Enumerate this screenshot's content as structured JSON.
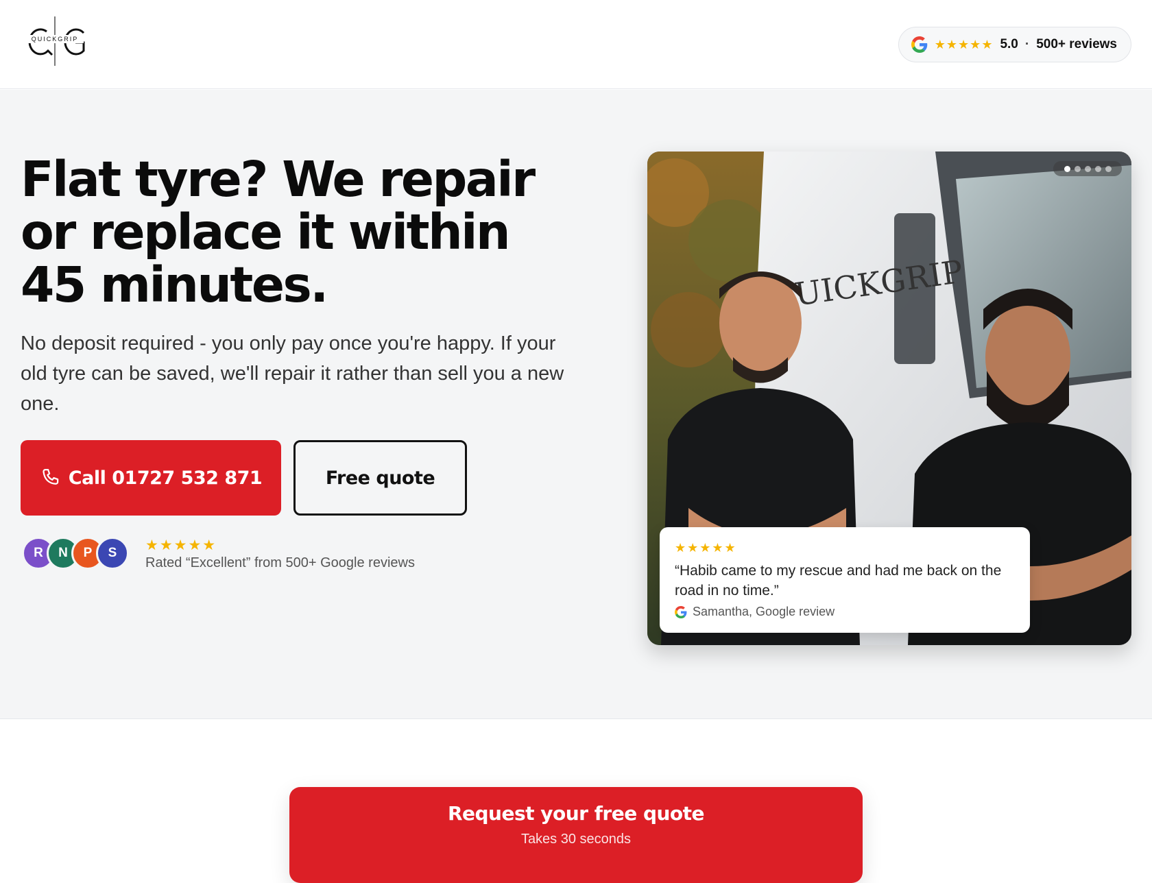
{
  "brand": {
    "logo_text": "QUICKGRIP",
    "logo_letters": "QG"
  },
  "header": {
    "rating": {
      "icon": "google-g-icon",
      "stars": "★★★★★",
      "score": "5.0",
      "separator": "·",
      "reviews": "500+ reviews"
    }
  },
  "hero": {
    "headline": "Flat tyre? We repair or replace it within 45 minutes.",
    "subtext": "No deposit required - you only pay once you're happy. If your old tyre can be saved, we'll repair it rather than sell you a new one.",
    "call_button": {
      "icon": "phone-icon",
      "label": "Call 01727 532 871"
    },
    "quote_button": {
      "label": "Free quote"
    },
    "social_proof": {
      "avatars": [
        {
          "initial": "R",
          "color": "#7b4fc9"
        },
        {
          "initial": "N",
          "color": "#1e7a5e"
        },
        {
          "initial": "P",
          "color": "#e8561f"
        },
        {
          "initial": "S",
          "color": "#3b47b3"
        }
      ],
      "stars": "★★★★★",
      "text": "Rated “Excellent” from 500+ Google reviews"
    }
  },
  "photo_card": {
    "carousel": {
      "count": 5,
      "active": 0
    },
    "review": {
      "stars": "★★★★★",
      "quote": "“Habib came to my rescue and had me back on the road in no time.”",
      "author": "Samantha, Google review"
    }
  },
  "cta": {
    "title": "Request your free quote",
    "subtitle": "Takes 30 seconds"
  },
  "colors": {
    "accent": "#dc1f26",
    "star": "#f5b400",
    "hero_bg": "#f4f5f6"
  }
}
